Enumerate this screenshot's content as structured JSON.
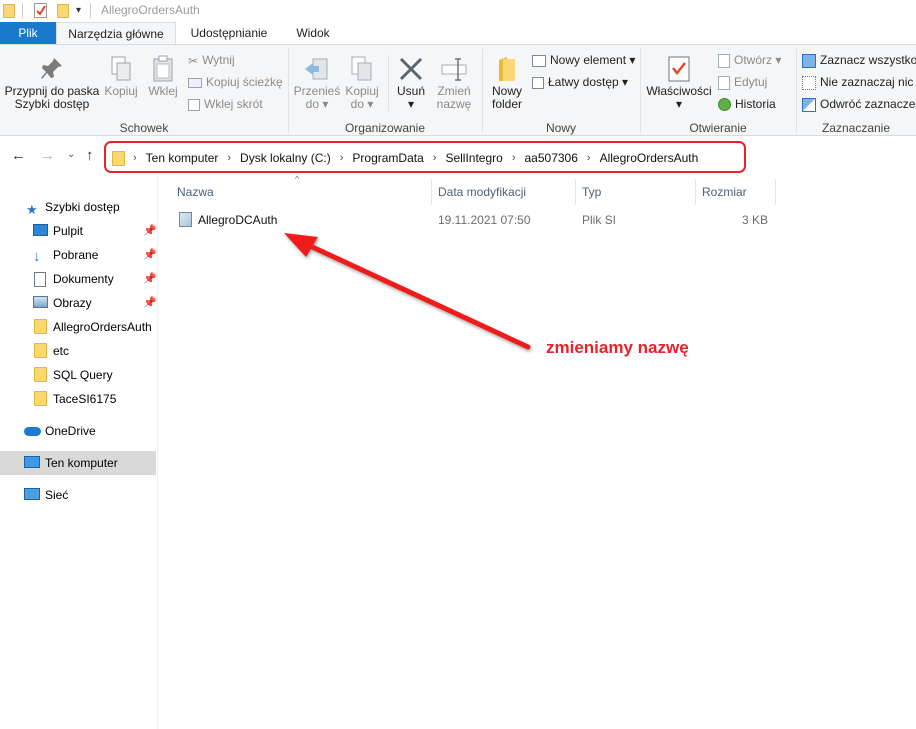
{
  "window": {
    "title": "AllegroOrdersAuth"
  },
  "tabs": [
    {
      "label": "Plik"
    },
    {
      "label": "Narzędzia główne"
    },
    {
      "label": "Udostępnianie"
    },
    {
      "label": "Widok"
    }
  ],
  "ribbon": {
    "groups": {
      "clipboard": "Schowek",
      "organize": "Organizowanie",
      "new": "Nowy",
      "open": "Otwieranie",
      "select": "Zaznaczanie"
    },
    "pin_quick_line1": "Przypnij do paska",
    "pin_quick_line2": "Szybki dostęp",
    "copy": "Kopiuj",
    "paste": "Wklej",
    "cut": "Wytnij",
    "copy_path": "Kopiuj ścieżkę",
    "paste_shortcut": "Wklej skrót",
    "move_to_line1": "Przenieś",
    "move_to_line2": "do",
    "copy_to_line1": "Kopiuj",
    "copy_to_line2": "do",
    "delete": "Usuń",
    "rename_line1": "Zmień",
    "rename_line2": "nazwę",
    "new_folder_line1": "Nowy",
    "new_folder_line2": "folder",
    "new_item": "Nowy element",
    "easy_access": "Łatwy dostęp",
    "properties": "Właściwości",
    "open": "Otwórz",
    "edit": "Edytuj",
    "history": "Historia",
    "select_all": "Zaznacz wszystko",
    "select_none": "Nie zaznaczaj nic",
    "invert_selection": "Odwróć zaznaczenie"
  },
  "address": {
    "crumbs": [
      "Ten komputer",
      "Dysk lokalny (C:)",
      "ProgramData",
      "SellIntegro",
      "aa507306",
      "AllegroOrdersAuth"
    ]
  },
  "sidebar": {
    "quick_access": "Szybki dostęp",
    "items": [
      {
        "label": "Pulpit"
      },
      {
        "label": "Pobrane"
      },
      {
        "label": "Dokumenty"
      },
      {
        "label": "Obrazy"
      },
      {
        "label": "AllegroOrdersAuth"
      },
      {
        "label": "etc"
      },
      {
        "label": "SQL Query"
      },
      {
        "label": "TaceSI6175"
      }
    ],
    "onedrive": "OneDrive",
    "this_pc": "Ten komputer",
    "network": "Sieć"
  },
  "file_list": {
    "columns": {
      "name": "Nazwa",
      "date": "Data modyfikacji",
      "type": "Typ",
      "size": "Rozmiar"
    },
    "rows": [
      {
        "name": "AllegroDCAuth",
        "date": "19.11.2021 07:50",
        "type": "Plik SI",
        "size": "3 KB"
      }
    ]
  },
  "annotation": {
    "text": "zmieniamy nazwę",
    "color": "#e8212b"
  }
}
